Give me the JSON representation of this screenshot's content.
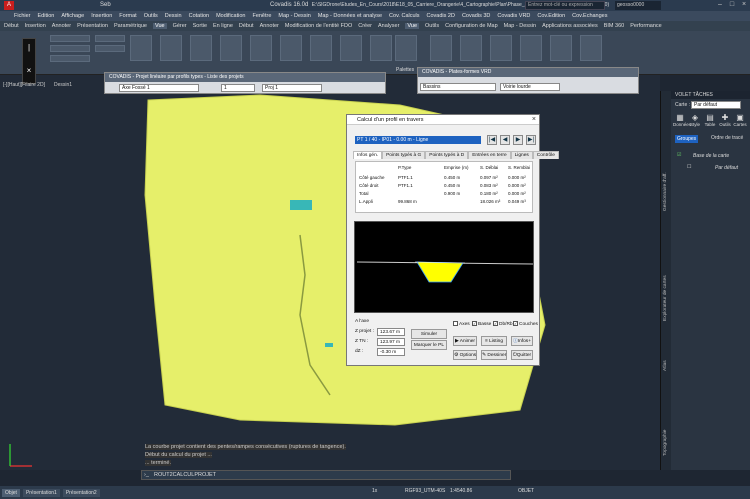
{
  "window": {
    "app_name": "Covadis 16.0d",
    "title": "E:\\SIGDrone\\Etudes_En_Cours\\2018\\E18_05_Carriere_Orangerie\\4_Cartographie\\Plan\\Phase_2\\E18_05_Plan_Phase_2.dwg (1:200)",
    "search_placeholder": "Entrez mot-clé ou expression",
    "user": "geosso0000",
    "app_label": "Seb"
  },
  "menubar": [
    "Fichier",
    "Edition",
    "Affichage",
    "Insertion",
    "Format",
    "Outils",
    "Dessin",
    "Cotation",
    "Modification",
    "Fenêtre",
    "Map - Dessin",
    "Map - Données et analyse",
    "Cov. Calculs",
    "Covadis 2D",
    "Covadis 3D",
    "Covadis VRD",
    "Cov.Edition",
    "Cov.Echanges"
  ],
  "ribbon_tabs": [
    "Début",
    "Insertion",
    "Annoter",
    "Présentation",
    "Paramétrique",
    "Vue",
    "Gérer",
    "Sortie",
    "En ligne",
    "Début",
    "Annoter",
    "Modification de l'entité FDO",
    "Créer",
    "Analyser",
    "Vue",
    "Outils",
    "Configuration de Map",
    "Map - Dessin",
    "Applications associées",
    "BIM 360",
    "Performance"
  ],
  "ribbon_active_tab": "Vue",
  "ribbon_labels": {
    "palettes": "Palettes"
  },
  "viewport_tabs": [
    "[-][Haut][Filaire 2D]",
    "Dessin1"
  ],
  "panel_projet": {
    "title": "COVADIS - Projet linéaire par profils types - Liste des projets",
    "axe": "Axe Fossé 1",
    "num": "1",
    "proj": "Proj 1"
  },
  "panel_plateformes": {
    "title": "COVADIS - Plates-formes VRD",
    "bassins": "Bassins",
    "voirie": "Voirie lourde"
  },
  "dialog": {
    "title": "Calcul d'un profil en travers",
    "selection": "PT 1 / 40  -  IP01  -  0.00 m  -  Ligne",
    "nav": [
      "|◀",
      "◀",
      "▶",
      "▶|"
    ],
    "tabs": [
      "Infos gén.",
      "Points typés à G",
      "Points typés à D",
      "Entrées en terre",
      "Lignes",
      "Contrôle"
    ],
    "table_headers": [
      "",
      "P.Type",
      "Emprise (m)",
      "S. Déblai",
      "S. Remblai"
    ],
    "rows": [
      [
        "Côté gauche",
        "PTF1.1",
        "0.450 m",
        "0.097 m²",
        "0.000 m²"
      ],
      [
        "Côté droit",
        "PTF1.1",
        "0.450 m",
        "0.083 m²",
        "0.000 m²"
      ],
      [
        "Total",
        "",
        "0.900 m",
        "0.180 m²",
        "0.000 m²"
      ],
      [
        "L.Appli",
        "99.868 m",
        "",
        "18.026 m³",
        "0.049 m³"
      ]
    ],
    "a_faxe_label": "A l'axe",
    "z_projet_label": "Z projet :",
    "z_projet": "123.67 m",
    "z_tn_label": "Z TN :",
    "z_tn": "123.97 m",
    "dz_label": "dZ :",
    "dz": "-0.30 m",
    "btn_simuler": "Simuler",
    "btn_marquer": "Marquer le PL",
    "checkboxes": [
      {
        "label": "Axes",
        "checked": false
      },
      {
        "label": "Basse",
        "checked": true
      },
      {
        "label": "Db/Rb",
        "checked": true
      },
      {
        "label": "Couches",
        "checked": true
      }
    ],
    "btn_animer": "Animer",
    "btn_listing": "Listing",
    "btn_infos": "Infos+",
    "btn_options": "Options",
    "btn_dessiner": "Dessiner",
    "btn_quitter": "Quitter"
  },
  "right_panel": {
    "title": "VOLET TÂCHES",
    "carte_label": "Carte :",
    "carte_value": "Par défaut",
    "tools": [
      "Données",
      "Style",
      "Table",
      "Outils",
      "Cartes"
    ],
    "tab_groups": "Groupes",
    "tab_order": "Ordre de tracé",
    "layer1": "Base de la carte",
    "layer2": "Par défaut",
    "vertical_labels": [
      "Gestionnaire d'aff.",
      "Explorateur de cartes",
      "Atlas",
      "Topographie"
    ]
  },
  "command": {
    "history": [
      "La courbe projet contient des pentes/rampes consécutives (ruptures de tangence).",
      "Début du calcul du projet ...",
      "... terminé."
    ],
    "current": "ROUT2CALCULPROJET"
  },
  "statusbar": {
    "tabs": [
      "Objet",
      "Présentation1",
      "Présentation2"
    ],
    "scale": "1:4540.86",
    "coord_sys": "RGF93_UTM-40S",
    "mode": "OBJET",
    "zoom": "1x"
  },
  "colors": {
    "terrain": "#e6ef6a",
    "profile_fill": "#ffff00",
    "selection": "#1e62c0"
  }
}
